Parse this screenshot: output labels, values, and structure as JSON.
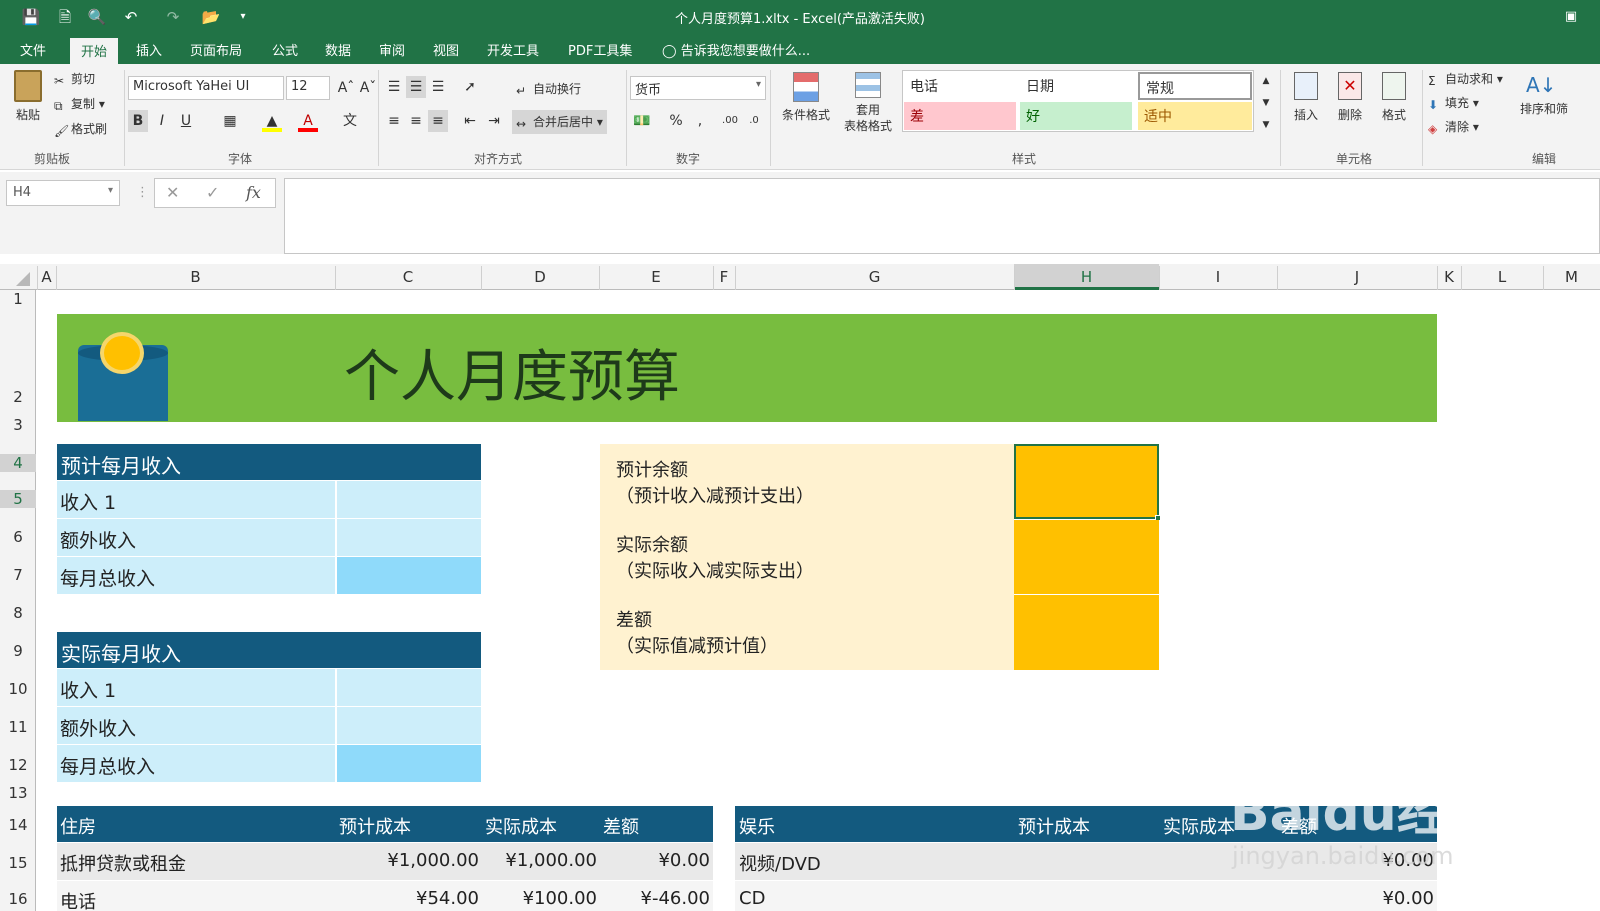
{
  "window": {
    "title": "个人月度预算1.xltx - Excel(产品激活失败)"
  },
  "ribbon_tabs": [
    "文件",
    "开始",
    "插入",
    "页面布局",
    "公式",
    "数据",
    "审阅",
    "视图",
    "开发工具",
    "PDF工具集"
  ],
  "tell_me": "告诉我您想要做什么...",
  "clipboard": {
    "paste": "粘贴",
    "cut": "剪切",
    "copy": "复制",
    "format_painter": "格式刷",
    "group_label": "剪贴板"
  },
  "font": {
    "name": "Microsoft YaHei UI",
    "size": "12",
    "bold": "B",
    "italic": "I",
    "underline": "U",
    "group_label": "字体"
  },
  "alignment": {
    "wrap_text": "自动换行",
    "merge_center": "合并后居中",
    "group_label": "对齐方式"
  },
  "number": {
    "format": "货币",
    "group_label": "数字"
  },
  "styles": {
    "conditional_formatting": "条件格式",
    "format_as_table_line1": "套用",
    "format_as_table_line2": "表格格式",
    "cells": [
      "电话",
      "日期",
      "常规",
      "差",
      "好",
      "适中"
    ],
    "group_label": "样式"
  },
  "cells_group": {
    "insert": "插入",
    "delete": "删除",
    "format": "格式",
    "group_label": "单元格"
  },
  "editing": {
    "autosum": "自动求和",
    "fill": "填充",
    "clear": "清除",
    "sort": "排序和筛",
    "group_label": "编辑"
  },
  "name_box": "H4",
  "columns": [
    "A",
    "B",
    "C",
    "D",
    "E",
    "F",
    "G",
    "H",
    "I",
    "J",
    "K",
    "L",
    "M"
  ],
  "rows": [
    "1",
    "2",
    "3",
    "4",
    "5",
    "6",
    "7",
    "8",
    "9",
    "10",
    "11",
    "12",
    "13",
    "14",
    "15",
    "16"
  ],
  "sheet": {
    "banner_title": "个人月度预算",
    "projected_income": {
      "header": "预计每月收入",
      "rows": [
        "收入 1",
        "额外收入",
        "每月总收入"
      ]
    },
    "actual_income": {
      "header": "实际每月收入",
      "rows": [
        "收入 1",
        "额外收入",
        "每月总收入"
      ]
    },
    "balance": [
      {
        "label": "预计余额",
        "sub": "（预计收入减预计支出）"
      },
      {
        "label": "实际余额",
        "sub": "（实际收入减实际支出）"
      },
      {
        "label": "差额",
        "sub": "（实际值减预计值）"
      }
    ],
    "housing": {
      "headers": [
        "住房",
        "预计成本",
        "实际成本",
        "差额"
      ],
      "rows": [
        [
          "抵押贷款或租金",
          "¥1,000.00",
          "¥1,000.00",
          "¥0.00"
        ],
        [
          "电话",
          "¥54.00",
          "¥100.00",
          "¥-46.00"
        ]
      ]
    },
    "entertainment": {
      "headers": [
        "娱乐",
        "预计成本",
        "实际成本",
        "差额"
      ],
      "rows": [
        [
          "视频/DVD",
          "¥0.00"
        ],
        [
          "CD",
          "¥0.00"
        ]
      ]
    }
  },
  "watermark": {
    "brand": "Baidu经验",
    "url": "jingyan.baidu.com"
  }
}
